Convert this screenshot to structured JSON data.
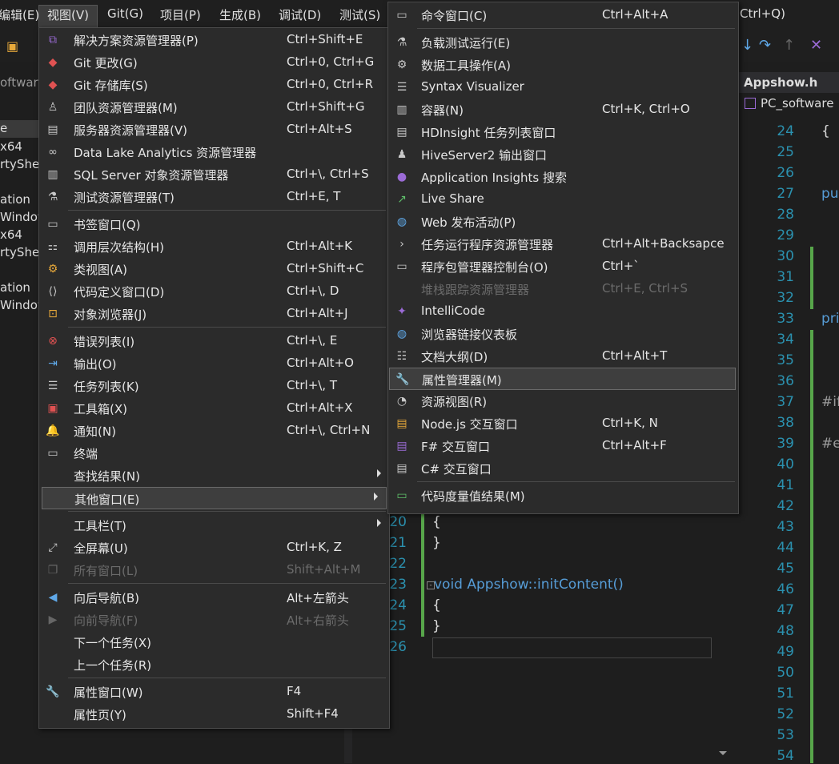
{
  "menubar": {
    "items": [
      "编辑(E)",
      "视图(V)",
      "Git(G)",
      "项目(P)",
      "生成(B)",
      "调试(D)",
      "测试(S)"
    ],
    "search_hint": "Ctrl+Q)"
  },
  "left_panel": {
    "lines": [
      "oftware",
      "e",
      "x64",
      "rtySheet",
      "ation",
      "Window",
      "x64",
      "rtySheet",
      "ation",
      "Window"
    ]
  },
  "tabs": {
    "appshow": "Appshow.h",
    "scope": "PC_software"
  },
  "view_menu": {
    "items": [
      {
        "label": "解决方案资源管理器(P)",
        "shortcut": "Ctrl+Shift+E",
        "icon": "solution-explorer-icon"
      },
      {
        "label": "Git 更改(G)",
        "shortcut": "Ctrl+0, Ctrl+G",
        "icon": "git-changes-icon"
      },
      {
        "label": "Git 存储库(S)",
        "shortcut": "Ctrl+0, Ctrl+R",
        "icon": "git-repository-icon"
      },
      {
        "label": "团队资源管理器(M)",
        "shortcut": "Ctrl+Shift+G",
        "icon": "team-explorer-icon"
      },
      {
        "label": "服务器资源管理器(V)",
        "shortcut": "Ctrl+Alt+S",
        "icon": "server-explorer-icon"
      },
      {
        "label": "Data Lake Analytics 资源管理器",
        "shortcut": "",
        "icon": "binoculars-icon"
      },
      {
        "label": "SQL Server 对象资源管理器",
        "shortcut": "Ctrl+\\, Ctrl+S",
        "icon": "sql-server-icon"
      },
      {
        "label": "测试资源管理器(T)",
        "shortcut": "Ctrl+E, T",
        "icon": "test-explorer-icon"
      },
      {
        "label": "书签窗口(Q)",
        "shortcut": "",
        "icon": "bookmark-icon"
      },
      {
        "label": "调用层次结构(H)",
        "shortcut": "Ctrl+Alt+K",
        "icon": "call-hierarchy-icon"
      },
      {
        "label": "类视图(A)",
        "shortcut": "Ctrl+Shift+C",
        "icon": "class-view-icon"
      },
      {
        "label": "代码定义窗口(D)",
        "shortcut": "Ctrl+\\, D",
        "icon": "code-definition-icon"
      },
      {
        "label": "对象浏览器(J)",
        "shortcut": "Ctrl+Alt+J",
        "icon": "object-browser-icon"
      },
      {
        "label": "错误列表(I)",
        "shortcut": "Ctrl+\\, E",
        "icon": "error-list-icon"
      },
      {
        "label": "输出(O)",
        "shortcut": "Ctrl+Alt+O",
        "icon": "output-icon"
      },
      {
        "label": "任务列表(K)",
        "shortcut": "Ctrl+\\, T",
        "icon": "task-list-icon"
      },
      {
        "label": "工具箱(X)",
        "shortcut": "Ctrl+Alt+X",
        "icon": "toolbox-icon"
      },
      {
        "label": "通知(N)",
        "shortcut": "Ctrl+\\, Ctrl+N",
        "icon": "notification-bell-icon"
      },
      {
        "label": "终端",
        "shortcut": "",
        "icon": "terminal-icon"
      },
      {
        "label": "查找结果(N)",
        "shortcut": "",
        "icon": ""
      },
      {
        "label": "其他窗口(E)",
        "shortcut": "",
        "icon": ""
      },
      {
        "label": "工具栏(T)",
        "shortcut": "",
        "icon": ""
      },
      {
        "label": "全屏幕(U)",
        "shortcut": "Ctrl+K, Z",
        "icon": "fullscreen-icon"
      },
      {
        "label": "所有窗口(L)",
        "shortcut": "Shift+Alt+M",
        "icon": "all-windows-icon"
      },
      {
        "label": "向后导航(B)",
        "shortcut": "Alt+左箭头",
        "icon": "navigate-back-icon"
      },
      {
        "label": "向前导航(F)",
        "shortcut": "Alt+右箭头",
        "icon": "navigate-forward-icon"
      },
      {
        "label": "下一个任务(X)",
        "shortcut": "",
        "icon": ""
      },
      {
        "label": "上一个任务(R)",
        "shortcut": "",
        "icon": ""
      },
      {
        "label": "属性窗口(W)",
        "shortcut": "F4",
        "icon": "wrench-icon"
      },
      {
        "label": "属性页(Y)",
        "shortcut": "Shift+F4",
        "icon": ""
      }
    ]
  },
  "other_windows_menu": {
    "items": [
      {
        "label": "命令窗口(C)",
        "shortcut": "Ctrl+Alt+A",
        "icon": "command-window-icon"
      },
      {
        "label": "负载测试运行(E)",
        "shortcut": "",
        "icon": "load-test-icon"
      },
      {
        "label": "数据工具操作(A)",
        "shortcut": "",
        "icon": "data-tools-icon"
      },
      {
        "label": "Syntax Visualizer",
        "shortcut": "",
        "icon": "syntax-visualizer-icon"
      },
      {
        "label": "容器(N)",
        "shortcut": "Ctrl+K, Ctrl+O",
        "icon": "container-icon"
      },
      {
        "label": "HDInsight 任务列表窗口",
        "shortcut": "",
        "icon": "hdinsight-icon"
      },
      {
        "label": "HiveServer2 输出窗口",
        "shortcut": "",
        "icon": "hiveserver-icon"
      },
      {
        "label": "Application Insights 搜索",
        "shortcut": "",
        "icon": "app-insights-icon"
      },
      {
        "label": "Live Share",
        "shortcut": "",
        "icon": "live-share-icon"
      },
      {
        "label": "Web 发布活动(P)",
        "shortcut": "",
        "icon": "web-publish-icon"
      },
      {
        "label": "任务运行程序资源管理器",
        "shortcut": "Ctrl+Alt+Backsapce",
        "icon": "task-runner-icon"
      },
      {
        "label": "程序包管理器控制台(O)",
        "shortcut": "Ctrl+`",
        "icon": "package-manager-icon"
      },
      {
        "label": "堆栈跟踪资源管理器",
        "shortcut": "Ctrl+E, Ctrl+S",
        "icon": ""
      },
      {
        "label": "IntelliCode",
        "shortcut": "",
        "icon": "intellicode-icon"
      },
      {
        "label": "浏览器链接仪表板",
        "shortcut": "",
        "icon": "browser-link-icon"
      },
      {
        "label": "文档大纲(D)",
        "shortcut": "Ctrl+Alt+T",
        "icon": "document-outline-icon"
      },
      {
        "label": "属性管理器(M)",
        "shortcut": "",
        "icon": "wrench-icon"
      },
      {
        "label": "资源视图(R)",
        "shortcut": "",
        "icon": "resource-view-icon"
      },
      {
        "label": "Node.js 交互窗口",
        "shortcut": "Ctrl+K, N",
        "icon": "nodejs-icon"
      },
      {
        "label": "F# 交互窗口",
        "shortcut": "Ctrl+Alt+F",
        "icon": "fsharp-icon"
      },
      {
        "label": "C# 交互窗口",
        "shortcut": "",
        "icon": "csharp-icon"
      },
      {
        "label": "代码度量值结果(M)",
        "shortcut": "",
        "icon": "code-metrics-icon"
      }
    ]
  },
  "editor_mid": {
    "line_numbers": [
      "20",
      "21",
      "22",
      "23",
      "24",
      "25",
      "26"
    ],
    "code_lines": [
      "{",
      "}",
      "",
      "void Appshow::initContent()",
      "{",
      "}",
      ""
    ]
  },
  "editor_right": {
    "line_numbers": [
      "24",
      "25",
      "26",
      "27",
      "28",
      "29",
      "30",
      "31",
      "32",
      "33",
      "34",
      "35",
      "36",
      "37",
      "38",
      "39",
      "40",
      "41",
      "42",
      "43",
      "44",
      "45",
      "46",
      "47",
      "48",
      "49",
      "50",
      "51",
      "52",
      "53",
      "54"
    ],
    "snippets": {
      "l24": "{",
      "l27": "pu",
      "l33": "pri",
      "l37": "#if",
      "l39": "#e"
    }
  }
}
